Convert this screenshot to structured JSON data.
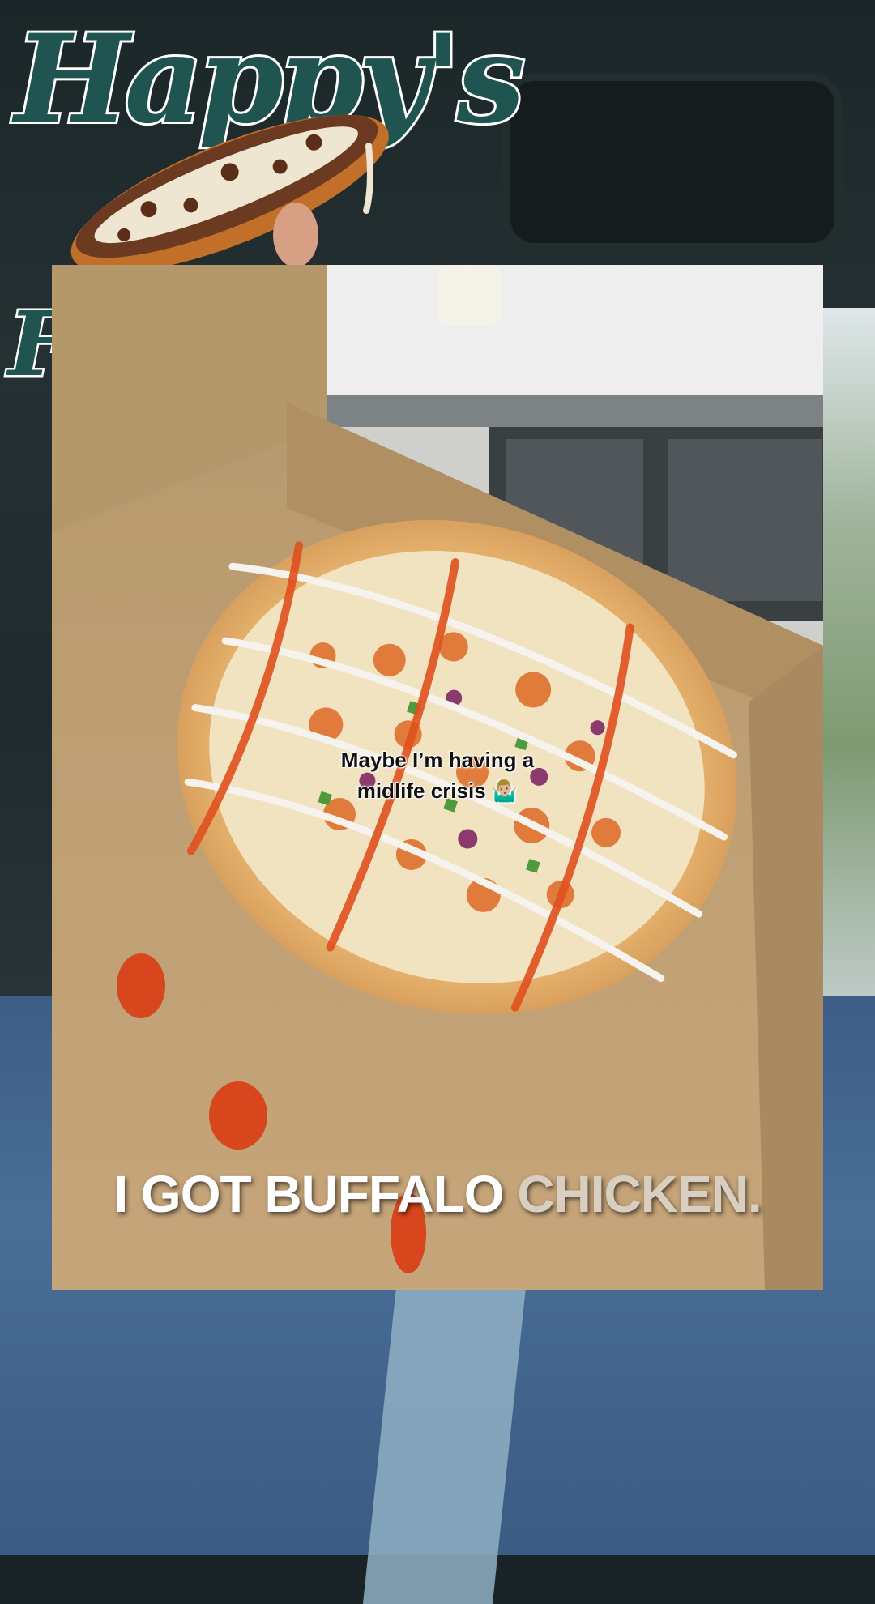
{
  "overlay": {
    "logo_text": "Happy's",
    "logo_partial_letter": "F"
  },
  "video": {
    "caption_small_line1": "Maybe I’m having a",
    "caption_small_line2": "midlife crisis 🤷🏼‍♂️",
    "caption_big_part1": "I GOT BUFFALO",
    "caption_big_part2": "CHICKEN."
  },
  "colors": {
    "logo_green": "#1f5450",
    "cardboard": "#bfa27a",
    "buffalo_sauce": "#e0501e",
    "ranch": "#f4f1ea"
  }
}
